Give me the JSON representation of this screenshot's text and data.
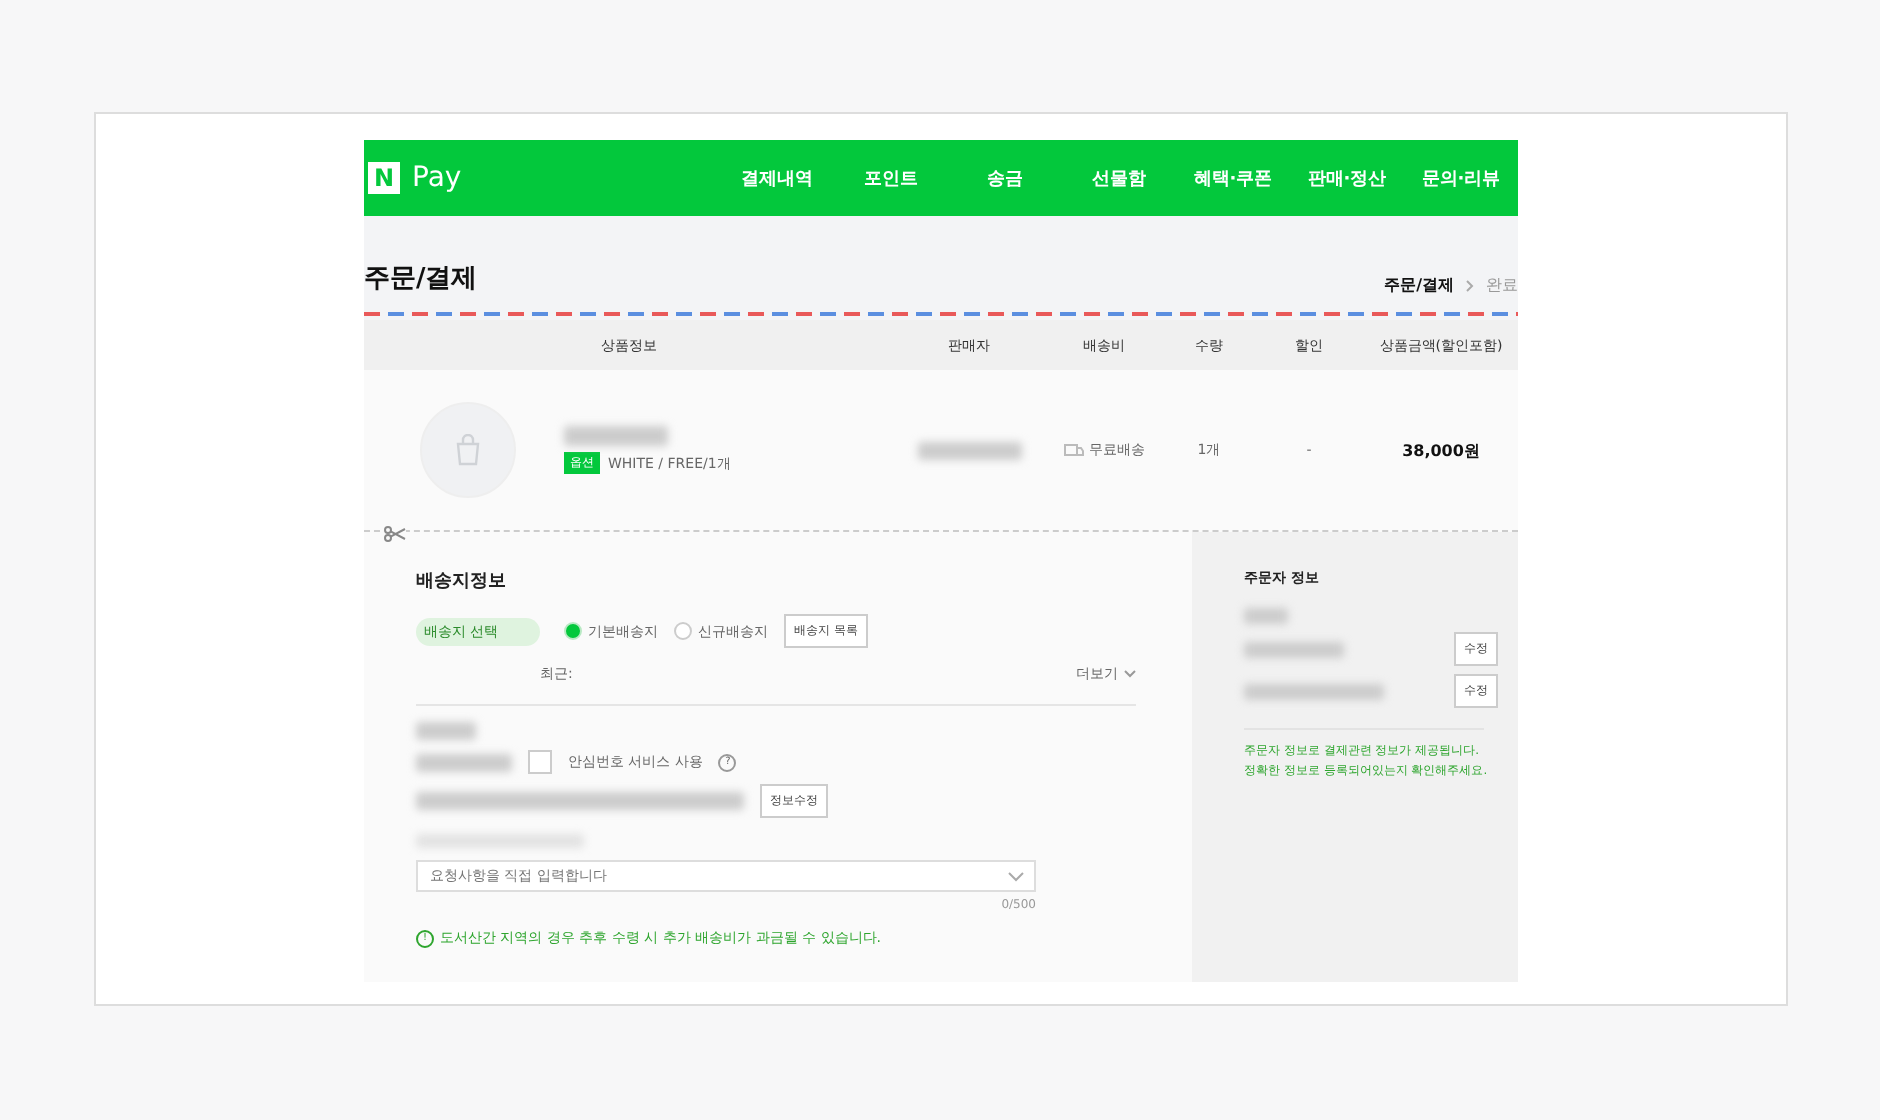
{
  "header": {
    "logo_mark": "N",
    "logo_text": "Pay",
    "nav": [
      {
        "label": "결제내역"
      },
      {
        "label": "포인트"
      },
      {
        "label": "송금"
      },
      {
        "label": "선물함"
      },
      {
        "label": "혜택·쿠폰"
      },
      {
        "label": "판매·정산"
      },
      {
        "label": "문의·리뷰"
      }
    ]
  },
  "page_title": "주문/결제",
  "breadcrumb": [
    {
      "label": "주문/결제",
      "selected": true
    },
    {
      "label": "완료",
      "selected": false
    }
  ],
  "table": {
    "columns": [
      "상품정보",
      "판매자",
      "배송비",
      "수량",
      "할인",
      "상품금액(할인포함)"
    ],
    "rows": [
      {
        "option_badge": "옵션",
        "option": "WHITE / FREE/1개",
        "shipping": "무료배송",
        "quantity": "1개",
        "discount": "-",
        "price": "38,000원"
      }
    ]
  },
  "delivery": {
    "title": "배송지정보",
    "select_label": "배송지 선택",
    "choices": [
      {
        "label": "기본배송지",
        "selected": true
      },
      {
        "label": "신규배송지",
        "selected": false
      }
    ],
    "list_button": "배송지 목록",
    "recent_label": "최근:",
    "more": "더보기",
    "safe_number": {
      "label": "안심번호 서비스 사용",
      "checked": false,
      "help": "?"
    },
    "edit_button": "정보수정",
    "request": {
      "placeholder": "요청사항을 직접 입력합니다",
      "counter": "0/500"
    },
    "notice_icon": "!",
    "notice": "도서산간 지역의 경우 추후 수령 시 추가 배송비가 과금될 수 있습니다."
  },
  "orderer": {
    "title": "주문자 정보",
    "edit_buttons": [
      "수정",
      "수정"
    ],
    "notice": [
      "주문자 정보로 결제관련 정보가 제공됩니다.",
      "정확한 정보로 등록되어있는지 확인해주세요."
    ]
  }
}
